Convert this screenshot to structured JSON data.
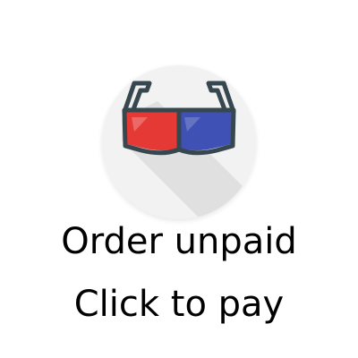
{
  "icon": {
    "name": "3d-glasses-icon",
    "background_color": "#f2f2f2",
    "frame_color": "#37474f",
    "left_lens_color": "#e53935",
    "right_lens_color": "#3f51b5"
  },
  "message": {
    "line1": "Order unpaid",
    "line2": "Click to pay"
  }
}
